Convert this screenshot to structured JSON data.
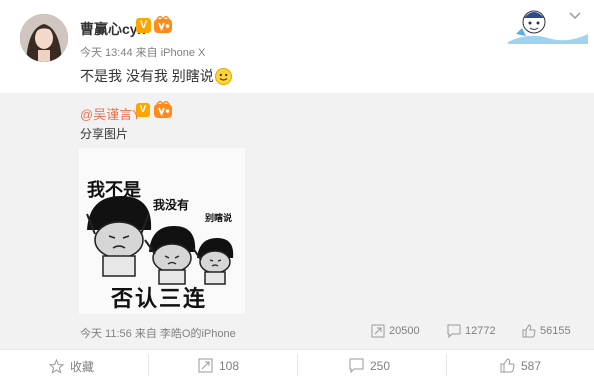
{
  "post": {
    "username": "曹赢心cyx",
    "v_badge": "V",
    "time": "今天 13:44",
    "source": "来自 iPhone X",
    "text": "不是我 没有我 别瞎说"
  },
  "repost": {
    "username": "@吴谨言Y",
    "v_badge": "V",
    "text": "分享图片",
    "meme": {
      "line1": "我不是",
      "line2": "我没有",
      "line3": "别瞎说",
      "caption": "否认三连"
    },
    "time": "今天 11:56",
    "source": "来自 李皓O的iPhone",
    "stats": {
      "reposts": "20500",
      "comments": "12772",
      "likes": "56155"
    }
  },
  "actions": {
    "favorite": "收藏",
    "reposts": "108",
    "comments": "250",
    "likes": "587"
  },
  "colors": {
    "link": "#eb7350",
    "badge": "#ffa500",
    "repost_bg": "#f2f2f2"
  }
}
